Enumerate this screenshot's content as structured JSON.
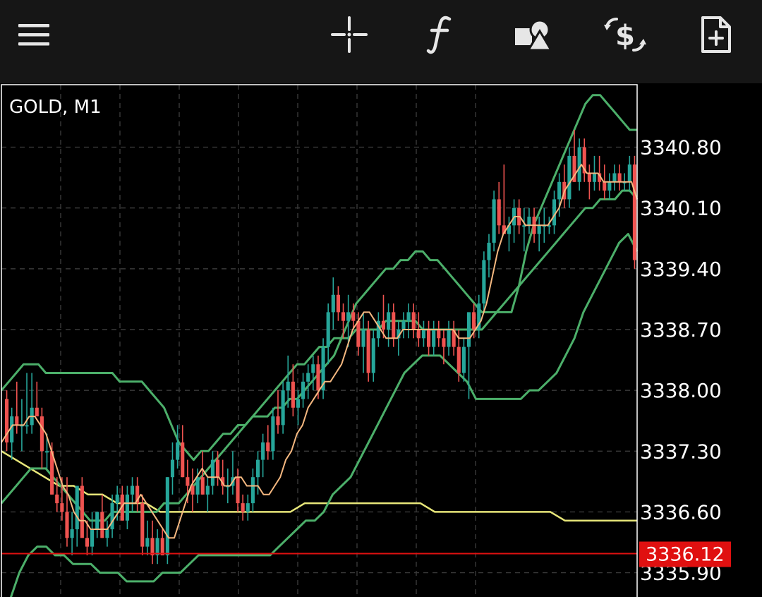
{
  "toolbar": {
    "buttons": [
      {
        "name": "menu-button",
        "icon": "hamburger-menu-icon"
      },
      {
        "name": "crosshair-button",
        "icon": "crosshair-icon"
      },
      {
        "name": "indicators-button",
        "icon": "function-icon"
      },
      {
        "name": "objects-button",
        "icon": "shapes-icon"
      },
      {
        "name": "trade-button",
        "icon": "dollar-exchange-icon"
      },
      {
        "name": "new-order-button",
        "icon": "new-document-icon"
      }
    ],
    "icon_color": "#e6e6e6",
    "background": "#161616"
  },
  "chart": {
    "symbol_label": "GOLD, M1",
    "current_price_label": "3336.12",
    "colors": {
      "bull": "#26a69a",
      "bear": "#ef5350",
      "bollinger": "#4caf6a",
      "ma_fast": "#f5b880",
      "ma_slow": "#e8e77a",
      "price_line": "#e01010",
      "grid": "#3a3a3a"
    }
  },
  "chart_data": {
    "type": "candlestick",
    "title": "GOLD, M1",
    "timeframe": "M1",
    "ylim": [
      3335.62,
      3341.52
    ],
    "y_ticks": [
      "3340.80",
      "3340.10",
      "3339.40",
      "3338.70",
      "3338.00",
      "3337.30",
      "3336.60",
      "3335.90"
    ],
    "current_price": 3336.12,
    "grid": true,
    "candles": [
      [
        3337.9,
        3338.0,
        3337.3,
        3337.4
      ],
      [
        3337.4,
        3337.8,
        3337.2,
        3337.7
      ],
      [
        3337.7,
        3338.1,
        3337.5,
        3337.6
      ],
      [
        3337.6,
        3337.9,
        3337.3,
        3337.6
      ],
      [
        3337.6,
        3338.2,
        3337.5,
        3337.6
      ],
      [
        3337.6,
        3338.2,
        3337.5,
        3337.8
      ],
      [
        3337.8,
        3338.1,
        3337.7,
        3337.7
      ],
      [
        3337.7,
        3337.8,
        3337.1,
        3337.3
      ],
      [
        3337.3,
        3337.5,
        3337.1,
        3337.3
      ],
      [
        3337.3,
        3337.4,
        3336.8,
        3336.8
      ],
      [
        3336.8,
        3337.0,
        3336.6,
        3336.7
      ],
      [
        3336.7,
        3337.0,
        3336.5,
        3336.6
      ],
      [
        3336.6,
        3337.0,
        3336.2,
        3336.3
      ],
      [
        3336.3,
        3336.6,
        3336.1,
        3336.4
      ],
      [
        3336.4,
        3336.9,
        3336.2,
        3336.9
      ],
      [
        3336.9,
        3337.0,
        3336.4,
        3336.3
      ],
      [
        3336.3,
        3336.5,
        3336.1,
        3336.2
      ],
      [
        3336.2,
        3336.6,
        3336.1,
        3336.4
      ],
      [
        3336.4,
        3336.6,
        3336.3,
        3336.6
      ],
      [
        3336.6,
        3336.8,
        3336.3,
        3336.3
      ],
      [
        3336.3,
        3336.5,
        3336.2,
        3336.4
      ],
      [
        3336.4,
        3336.8,
        3336.3,
        3336.7
      ],
      [
        3336.7,
        3336.9,
        3336.5,
        3336.8
      ],
      [
        3336.8,
        3336.9,
        3336.5,
        3336.5
      ],
      [
        3336.5,
        3336.9,
        3336.4,
        3336.8
      ],
      [
        3336.8,
        3337.0,
        3336.6,
        3336.9
      ],
      [
        3336.9,
        3337.0,
        3336.6,
        3336.7
      ],
      [
        3336.7,
        3336.8,
        3336.1,
        3336.2
      ],
      [
        3336.2,
        3336.5,
        3336.1,
        3336.3
      ],
      [
        3336.3,
        3336.5,
        3336.0,
        3336.1
      ],
      [
        3336.1,
        3336.4,
        3336.0,
        3336.3
      ],
      [
        3336.3,
        3336.4,
        3336.1,
        3336.1
      ],
      [
        3336.1,
        3337.0,
        3336.0,
        3337.0
      ],
      [
        3337.0,
        3337.4,
        3336.8,
        3337.2
      ],
      [
        3337.2,
        3337.6,
        3337.1,
        3337.4
      ],
      [
        3337.4,
        3337.6,
        3337.0,
        3337.0
      ],
      [
        3337.0,
        3337.2,
        3336.7,
        3336.9
      ],
      [
        3336.9,
        3337.1,
        3336.6,
        3336.8
      ],
      [
        3336.8,
        3337.1,
        3336.7,
        3337.0
      ],
      [
        3337.0,
        3337.3,
        3336.8,
        3336.8
      ],
      [
        3336.8,
        3337.0,
        3336.6,
        3336.9
      ],
      [
        3336.9,
        3337.3,
        3336.8,
        3337.2
      ],
      [
        3337.2,
        3337.3,
        3336.9,
        3337.0
      ],
      [
        3337.0,
        3337.2,
        3336.8,
        3336.9
      ],
      [
        3336.9,
        3337.1,
        3336.7,
        3336.9
      ],
      [
        3336.9,
        3337.3,
        3336.8,
        3337.0
      ],
      [
        3337.0,
        3337.1,
        3336.6,
        3336.7
      ],
      [
        3336.7,
        3336.8,
        3336.5,
        3336.6
      ],
      [
        3336.6,
        3336.8,
        3336.5,
        3336.7
      ],
      [
        3336.7,
        3337.1,
        3336.6,
        3337.0
      ],
      [
        3337.0,
        3337.3,
        3336.8,
        3337.2
      ],
      [
        3337.2,
        3337.5,
        3337.0,
        3337.4
      ],
      [
        3337.4,
        3337.6,
        3337.2,
        3337.3
      ],
      [
        3337.3,
        3337.8,
        3337.2,
        3337.7
      ],
      [
        3337.7,
        3338.0,
        3337.5,
        3337.6
      ],
      [
        3337.6,
        3338.1,
        3337.5,
        3338.0
      ],
      [
        3338.0,
        3338.4,
        3337.8,
        3338.1
      ],
      [
        3338.1,
        3338.3,
        3337.7,
        3337.8
      ],
      [
        3337.8,
        3338.0,
        3337.6,
        3337.9
      ],
      [
        3337.9,
        3338.2,
        3337.8,
        3338.1
      ],
      [
        3338.1,
        3338.3,
        3337.9,
        3338.2
      ],
      [
        3338.2,
        3338.4,
        3338.0,
        3338.3
      ],
      [
        3338.3,
        3338.4,
        3337.9,
        3338.0
      ],
      [
        3338.0,
        3338.6,
        3337.9,
        3338.5
      ],
      [
        3338.5,
        3339.0,
        3338.3,
        3338.9
      ],
      [
        3338.9,
        3339.3,
        3338.7,
        3339.1
      ],
      [
        3339.1,
        3339.2,
        3338.8,
        3338.9
      ],
      [
        3338.9,
        3339.0,
        3338.6,
        3338.8
      ],
      [
        3338.8,
        3339.1,
        3338.5,
        3338.9
      ],
      [
        3338.9,
        3339.0,
        3338.7,
        3338.8
      ],
      [
        3338.8,
        3338.9,
        3338.4,
        3338.5
      ],
      [
        3338.5,
        3338.9,
        3338.2,
        3338.7
      ],
      [
        3338.7,
        3338.8,
        3338.1,
        3338.2
      ],
      [
        3338.2,
        3338.7,
        3338.1,
        3338.6
      ],
      [
        3338.6,
        3338.9,
        3338.5,
        3338.8
      ],
      [
        3338.8,
        3339.1,
        3338.6,
        3338.7
      ],
      [
        3338.7,
        3339.0,
        3338.5,
        3338.9
      ],
      [
        3338.9,
        3339.0,
        3338.5,
        3338.6
      ],
      [
        3338.6,
        3338.8,
        3338.4,
        3338.7
      ],
      [
        3338.7,
        3338.9,
        3338.6,
        3338.8
      ],
      [
        3338.8,
        3339.0,
        3338.6,
        3338.9
      ],
      [
        3338.9,
        3339.0,
        3338.6,
        3338.7
      ],
      [
        3338.7,
        3338.9,
        3338.5,
        3338.6
      ],
      [
        3338.6,
        3338.8,
        3338.5,
        3338.7
      ],
      [
        3338.7,
        3338.8,
        3338.4,
        3338.5
      ],
      [
        3338.5,
        3338.8,
        3338.4,
        3338.7
      ],
      [
        3338.7,
        3338.8,
        3338.5,
        3338.6
      ],
      [
        3338.6,
        3338.7,
        3338.3,
        3338.5
      ],
      [
        3338.5,
        3338.8,
        3338.4,
        3338.7
      ],
      [
        3338.7,
        3338.8,
        3338.4,
        3338.5
      ],
      [
        3338.5,
        3338.7,
        3338.1,
        3338.2
      ],
      [
        3338.2,
        3338.6,
        3338.1,
        3338.5
      ],
      [
        3338.5,
        3338.9,
        3337.9,
        3338.9
      ],
      [
        3338.9,
        3339.0,
        3338.6,
        3338.7
      ],
      [
        3338.7,
        3339.1,
        3338.6,
        3339.0
      ],
      [
        3339.0,
        3339.6,
        3338.9,
        3339.5
      ],
      [
        3339.5,
        3339.8,
        3339.3,
        3339.7
      ],
      [
        3339.7,
        3340.3,
        3339.6,
        3340.2
      ],
      [
        3340.2,
        3340.4,
        3339.8,
        3339.9
      ],
      [
        3339.9,
        3340.6,
        3339.8,
        3339.8
      ],
      [
        3339.8,
        3340.0,
        3339.6,
        3339.9
      ],
      [
        3339.9,
        3340.2,
        3339.7,
        3340.1
      ],
      [
        3340.1,
        3340.2,
        3339.8,
        3339.9
      ],
      [
        3339.9,
        3340.1,
        3339.6,
        3339.9
      ],
      [
        3339.9,
        3340.1,
        3339.8,
        3340.0
      ],
      [
        3340.0,
        3340.1,
        3339.7,
        3339.8
      ],
      [
        3339.8,
        3340.0,
        3339.6,
        3339.9
      ],
      [
        3339.9,
        3340.1,
        3339.7,
        3339.9
      ],
      [
        3339.9,
        3340.0,
        3339.8,
        3339.9
      ],
      [
        3339.9,
        3340.3,
        3339.8,
        3340.2
      ],
      [
        3340.2,
        3340.5,
        3340.0,
        3340.4
      ],
      [
        3340.4,
        3340.6,
        3340.1,
        3340.2
      ],
      [
        3340.2,
        3340.8,
        3340.1,
        3340.7
      ],
      [
        3340.7,
        3341.0,
        3340.4,
        3340.4
      ],
      [
        3340.4,
        3340.9,
        3340.3,
        3340.8
      ],
      [
        3340.8,
        3340.9,
        3340.4,
        3340.5
      ],
      [
        3340.5,
        3340.6,
        3340.2,
        3340.4
      ],
      [
        3340.4,
        3340.7,
        3340.3,
        3340.5
      ],
      [
        3340.5,
        3340.7,
        3340.3,
        3340.4
      ],
      [
        3340.4,
        3340.6,
        3340.2,
        3340.3
      ],
      [
        3340.3,
        3340.5,
        3340.2,
        3340.4
      ],
      [
        3340.4,
        3340.6,
        3340.3,
        3340.5
      ],
      [
        3340.5,
        3340.6,
        3340.3,
        3340.4
      ],
      [
        3340.4,
        3340.5,
        3340.3,
        3340.4
      ],
      [
        3340.4,
        3340.7,
        3340.3,
        3340.6
      ],
      [
        3340.6,
        3340.7,
        3339.4,
        3339.5
      ]
    ],
    "series": [
      {
        "type": "bollinger_upper",
        "values": [
          3338.0,
          3338.1,
          3338.2,
          3338.3,
          3338.3,
          3338.3,
          3338.2,
          3338.2,
          3338.2,
          3338.2,
          3338.2,
          3338.2,
          3338.2,
          3338.2,
          3338.2,
          3338.2,
          3338.1,
          3338.1,
          3338.1,
          3338.1,
          3338.0,
          3337.9,
          3337.8,
          3337.6,
          3337.4,
          3337.3,
          3337.2,
          3337.3,
          3337.3,
          3337.4,
          3337.5,
          3337.5,
          3337.6,
          3337.6,
          3337.7,
          3337.7,
          3337.7,
          3337.8,
          3337.8,
          3337.9,
          3337.9,
          3338.0,
          3338.1,
          3338.2,
          3338.3,
          3338.4,
          3338.6,
          3338.8,
          3339.0,
          3339.1,
          3339.2,
          3339.3,
          3339.4,
          3339.4,
          3339.5,
          3339.5,
          3339.6,
          3339.6,
          3339.5,
          3339.5,
          3339.4,
          3339.3,
          3339.2,
          3339.1,
          3339.0,
          3338.9,
          3338.9,
          3338.9,
          3338.9,
          3338.9,
          3339.2,
          3339.6,
          3339.9,
          3340.1,
          3340.3,
          3340.5,
          3340.7,
          3340.9,
          3341.1,
          3341.3,
          3341.4,
          3341.4,
          3341.3,
          3341.2,
          3341.1,
          3341.0,
          3341.0
        ]
      },
      {
        "type": "bollinger_middle",
        "values": [
          3336.7,
          3336.8,
          3336.9,
          3337.0,
          3337.1,
          3337.1,
          3337.1,
          3337.0,
          3336.9,
          3336.8,
          3336.7,
          3336.6,
          3336.5,
          3336.5,
          3336.5,
          3336.6,
          3336.6,
          3336.6,
          3336.6,
          3336.6,
          3336.6,
          3336.6,
          3336.7,
          3336.7,
          3336.7,
          3336.8,
          3336.9,
          3337.0,
          3337.1,
          3337.2,
          3337.3,
          3337.4,
          3337.5,
          3337.6,
          3337.7,
          3337.8,
          3337.9,
          3338.0,
          3338.1,
          3338.2,
          3338.3,
          3338.3,
          3338.4,
          3338.5,
          3338.5,
          3338.6,
          3338.6,
          3338.6,
          3338.7,
          3338.7,
          3338.7,
          3338.7,
          3338.8,
          3338.8,
          3338.8,
          3338.8,
          3338.8,
          3338.7,
          3338.7,
          3338.7,
          3338.7,
          3338.7,
          3338.7,
          3338.7,
          3338.7,
          3338.7,
          3338.8,
          3338.9,
          3339.0,
          3339.1,
          3339.2,
          3339.3,
          3339.4,
          3339.5,
          3339.6,
          3339.7,
          3339.8,
          3339.9,
          3340.0,
          3340.1,
          3340.1,
          3340.2,
          3340.2,
          3340.2,
          3340.3,
          3340.3,
          3340.2
        ]
      },
      {
        "type": "bollinger_lower",
        "values": [
          3335.4,
          3335.6,
          3335.9,
          3336.1,
          3336.2,
          3336.2,
          3336.1,
          3336.1,
          3336.0,
          3336.0,
          3336.0,
          3335.9,
          3335.9,
          3335.9,
          3335.8,
          3335.8,
          3335.8,
          3335.8,
          3335.9,
          3335.9,
          3335.9,
          3336.0,
          3336.1,
          3336.1,
          3336.1,
          3336.1,
          3336.1,
          3336.1,
          3336.1,
          3336.1,
          3336.1,
          3336.2,
          3336.3,
          3336.4,
          3336.5,
          3336.5,
          3336.6,
          3336.8,
          3336.9,
          3337.0,
          3337.2,
          3337.4,
          3337.6,
          3337.8,
          3338.0,
          3338.2,
          3338.3,
          3338.4,
          3338.4,
          3338.4,
          3338.3,
          3338.2,
          3338.1,
          3337.9,
          3337.9,
          3337.9,
          3337.9,
          3337.9,
          3337.9,
          3338.0,
          3338.0,
          3338.1,
          3338.2,
          3338.4,
          3338.6,
          3338.9,
          3339.1,
          3339.3,
          3339.5,
          3339.7,
          3339.8,
          3339.6
        ]
      },
      {
        "type": "ma_fast",
        "values": [
          3337.4,
          3337.5,
          3337.6,
          3337.6,
          3337.6,
          3337.7,
          3337.7,
          3337.6,
          3337.5,
          3337.3,
          3337.1,
          3336.9,
          3336.8,
          3336.6,
          3336.5,
          3336.5,
          3336.4,
          3336.4,
          3336.4,
          3336.4,
          3336.5,
          3336.6,
          3336.7,
          3336.7,
          3336.7,
          3336.8,
          3336.7,
          3336.6,
          3336.5,
          3336.4,
          3336.3,
          3336.3,
          3336.5,
          3336.7,
          3336.9,
          3337.0,
          3337.1,
          3337.0,
          3337.0,
          3337.0,
          3336.9,
          3336.9,
          3337.0,
          3337.0,
          3336.9,
          3336.9,
          3336.9,
          3336.8,
          3336.8,
          3336.9,
          3337.0,
          3337.2,
          3337.3,
          3337.5,
          3337.6,
          3337.8,
          3337.9,
          3338.0,
          3338.1,
          3338.1,
          3338.2,
          3338.3,
          3338.5,
          3338.7,
          3338.8,
          3338.9,
          3338.9,
          3338.8,
          3338.7,
          3338.6,
          3338.6,
          3338.6,
          3338.7,
          3338.7,
          3338.7,
          3338.7,
          3338.7,
          3338.7,
          3338.7,
          3338.7,
          3338.7,
          3338.7,
          3338.6,
          3338.6,
          3338.6,
          3338.7,
          3338.8,
          3339.0,
          3339.3,
          3339.6,
          3339.8,
          3339.9,
          3340.0,
          3340.0,
          3339.9,
          3339.9,
          3339.9,
          3339.9,
          3339.9,
          3340.0,
          3340.1,
          3340.3,
          3340.4,
          3340.5,
          3340.6,
          3340.5,
          3340.5,
          3340.5,
          3340.4,
          3340.4,
          3340.4,
          3340.4,
          3340.4,
          3340.4,
          3340.2
        ]
      },
      {
        "type": "ma_slow",
        "values": [
          3337.3,
          3337.2,
          3337.1,
          3337.0,
          3336.9,
          3336.9,
          3336.8,
          3336.8,
          3336.7,
          3336.7,
          3336.7,
          3336.6,
          3336.6,
          3336.6,
          3336.6,
          3336.6,
          3336.6,
          3336.6,
          3336.6,
          3336.6,
          3336.6,
          3336.7,
          3336.7,
          3336.7,
          3336.7,
          3336.7,
          3336.7,
          3336.7,
          3336.7,
          3336.7,
          3336.6,
          3336.6,
          3336.6,
          3336.6,
          3336.6,
          3336.6,
          3336.6,
          3336.6,
          3336.6,
          3336.5,
          3336.5,
          3336.5,
          3336.5,
          3336.5,
          3336.5
        ]
      }
    ]
  }
}
